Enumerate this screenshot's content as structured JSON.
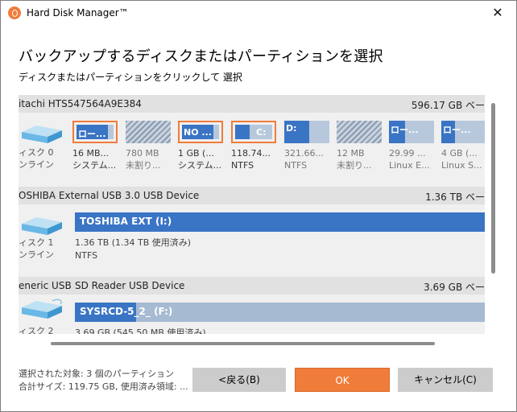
{
  "window": {
    "title": "Hard Disk Manager™",
    "close": "✕"
  },
  "heading": "バックアップするディスクまたはパーティションを選択",
  "subheading": "ディスクまたはパーティションをクリックして 選択",
  "disks": [
    {
      "name": "itachi HTS547564A9E384",
      "size": "596.17 GB ベー",
      "label_line1": "ィスク 0",
      "label_line2": "ンライン",
      "partitions": [
        {
          "label": "ロー...",
          "size": "16 MB...",
          "fs": "システム...",
          "selected": true,
          "fill": 0.55,
          "state": "used"
        },
        {
          "label": "",
          "size": "780 MB",
          "fs": "未割り...",
          "selected": false,
          "fill": 0,
          "state": "unallocated"
        },
        {
          "label": "NO ...",
          "size": "1 GB (...",
          "fs": "システム...",
          "selected": true,
          "fill": 0.75,
          "state": "used"
        },
        {
          "label": "C:",
          "size": "118.74...",
          "fs": "NTFS",
          "selected": true,
          "fill": 0.4,
          "state": "used"
        },
        {
          "label": "D:",
          "size": "321.66...",
          "fs": "NTFS",
          "selected": false,
          "fill": 0.55,
          "state": "used"
        },
        {
          "label": "",
          "size": "12 MB",
          "fs": "未割り...",
          "selected": false,
          "fill": 0,
          "state": "unallocated"
        },
        {
          "label": "ロー...",
          "size": "29.99 ...",
          "fs": "Linux E...",
          "selected": false,
          "fill": 0.35,
          "state": "used"
        },
        {
          "label": "ロー...",
          "size": "4 GB (...",
          "fs": "Linux S...",
          "selected": false,
          "fill": 0.3,
          "state": "used"
        }
      ]
    },
    {
      "name": "OSHIBA External USB 3.0 USB Device",
      "size": "1.36 TB ベー",
      "label_line1": "ィスク 1",
      "label_line2": "ンライン",
      "volume": {
        "label": "TOSHIBA EXT (I:)",
        "line1": "1.36 TB (1.34 TB 使用済み)",
        "line2": "NTFS",
        "fill": 1.0
      }
    },
    {
      "name_left": "eneric USB",
      "name_right": "SD Reader USB Device",
      "size": "3.69 GB ベー",
      "label_line1": "ィスク 2",
      "volume": {
        "label": "SYSRCD-5_2_ (F:)",
        "line1": "3.69 GB (545.50 MB 使用済み)",
        "fill": 0.15
      }
    }
  ],
  "status": {
    "line1": "選択された対象: 3 個のパーティション",
    "line2": "合計サイズ: 119.75 GB, 使用済み領域: ..."
  },
  "buttons": {
    "back": "<戻る(B)",
    "ok": "OK",
    "cancel": "キャンセル(C)"
  },
  "colors": {
    "accent": "#f07c3a",
    "used": "#3a74c4",
    "free": "#b8c8dc"
  }
}
